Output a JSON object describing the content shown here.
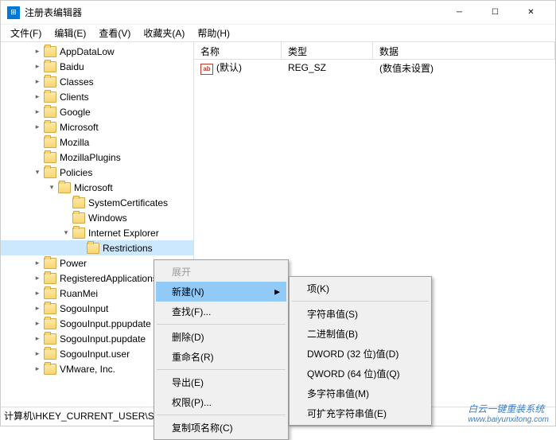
{
  "window": {
    "title": "注册表编辑器"
  },
  "menu": {
    "file": "文件(F)",
    "edit": "编辑(E)",
    "view": "查看(V)",
    "favorites": "收藏夹(A)",
    "help": "帮助(H)"
  },
  "tree": {
    "items": [
      {
        "indent": 2,
        "exp": "closed",
        "label": "AppDataLow"
      },
      {
        "indent": 2,
        "exp": "closed",
        "label": "Baidu"
      },
      {
        "indent": 2,
        "exp": "closed",
        "label": "Classes"
      },
      {
        "indent": 2,
        "exp": "closed",
        "label": "Clients"
      },
      {
        "indent": 2,
        "exp": "closed",
        "label": "Google"
      },
      {
        "indent": 2,
        "exp": "closed",
        "label": "Microsoft"
      },
      {
        "indent": 2,
        "exp": "none",
        "label": "Mozilla"
      },
      {
        "indent": 2,
        "exp": "none",
        "label": "MozillaPlugins"
      },
      {
        "indent": 2,
        "exp": "open",
        "label": "Policies"
      },
      {
        "indent": 3,
        "exp": "open",
        "label": "Microsoft"
      },
      {
        "indent": 4,
        "exp": "none",
        "label": "SystemCertificates"
      },
      {
        "indent": 4,
        "exp": "none",
        "label": "Windows"
      },
      {
        "indent": 4,
        "exp": "open",
        "label": "Internet Explorer"
      },
      {
        "indent": 5,
        "exp": "none",
        "label": "Restrictions",
        "selected": true
      },
      {
        "indent": 2,
        "exp": "closed",
        "label": "Power"
      },
      {
        "indent": 2,
        "exp": "closed",
        "label": "RegisteredApplications"
      },
      {
        "indent": 2,
        "exp": "closed",
        "label": "RuanMei"
      },
      {
        "indent": 2,
        "exp": "closed",
        "label": "SogouInput"
      },
      {
        "indent": 2,
        "exp": "closed",
        "label": "SogouInput.ppupdate"
      },
      {
        "indent": 2,
        "exp": "closed",
        "label": "SogouInput.pupdate"
      },
      {
        "indent": 2,
        "exp": "closed",
        "label": "SogouInput.user"
      },
      {
        "indent": 2,
        "exp": "closed",
        "label": "VMware, Inc."
      }
    ]
  },
  "list": {
    "cols": {
      "name": "名称",
      "type": "类型",
      "data": "数据"
    },
    "rows": [
      {
        "name": "(默认)",
        "type": "REG_SZ",
        "data": "(数值未设置)"
      }
    ]
  },
  "context1": {
    "expand": "展开",
    "new": "新建(N)",
    "find": "查找(F)...",
    "delete": "删除(D)",
    "rename": "重命名(R)",
    "export": "导出(E)",
    "permissions": "权限(P)...",
    "copyname": "复制项名称(C)"
  },
  "context2": {
    "key": "项(K)",
    "string": "字符串值(S)",
    "binary": "二进制值(B)",
    "dword": "DWORD (32 位)值(D)",
    "qword": "QWORD (64 位)值(Q)",
    "multistring": "多字符串值(M)",
    "expstring": "可扩充字符串值(E)"
  },
  "statusbar": {
    "path": "计算机\\HKEY_CURRENT_USER\\SOFTWARE\\Policies\\Microsoft\\Internet Explorer\\Restrictions"
  },
  "watermark": {
    "text": "白云一键重装系统",
    "url": "www.baiyunxitong.com"
  }
}
